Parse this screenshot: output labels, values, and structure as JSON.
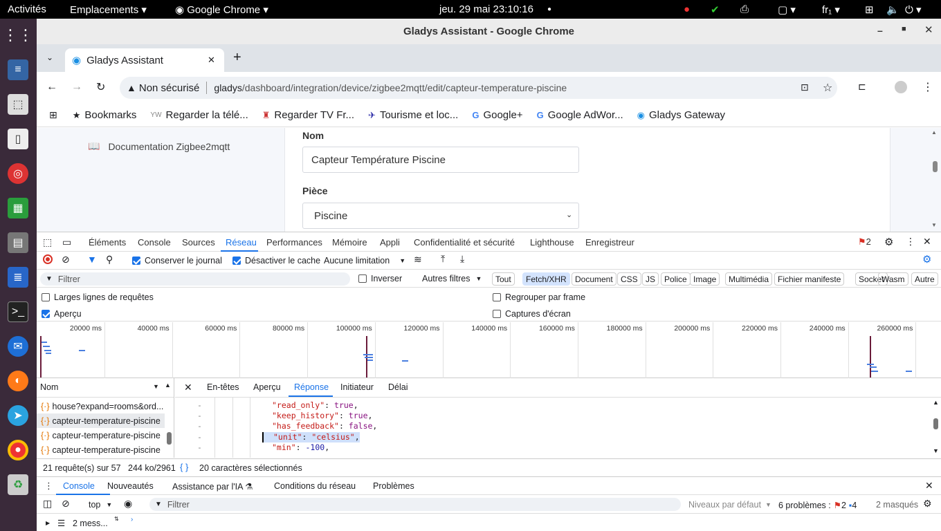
{
  "topbar": {
    "activities": "Activités",
    "places": "Emplacements",
    "app": "Google Chrome",
    "datetime": "jeu. 29 mai  23:10:16",
    "lang": "fr₁"
  },
  "window": {
    "title": "Gladys Assistant - Google Chrome"
  },
  "tab": {
    "title": "Gladys Assistant"
  },
  "omnibox": {
    "security": "Non sécurisé",
    "host": "gladys",
    "path": "/dashboard/integration/device/zigbee2mqtt/edit/capteur-temperature-piscine"
  },
  "bookmarks": [
    {
      "icon": "bookmarks-star-icon",
      "label": "Bookmarks"
    },
    {
      "icon": "yw-icon",
      "label": "Regarder la télé..."
    },
    {
      "icon": "tv-icon",
      "label": "Regarder TV Fr..."
    },
    {
      "icon": "plane-icon",
      "label": "Tourisme et loc..."
    },
    {
      "icon": "google-icon",
      "label": "Google+"
    },
    {
      "icon": "google-icon",
      "label": "Google AdWor..."
    },
    {
      "icon": "gladys-icon",
      "label": "Gladys Gateway"
    }
  ],
  "page": {
    "doc_link": "Documentation Zigbee2mqtt",
    "name_label": "Nom",
    "name_value": "Capteur Température Piscine",
    "room_label": "Pièce",
    "room_value": "Piscine"
  },
  "devtools": {
    "tabs": [
      "Éléments",
      "Console",
      "Sources",
      "Réseau",
      "Performances",
      "Mémoire",
      "Appli",
      "Confidentialité et sécurité",
      "Lighthouse",
      "Enregistreur"
    ],
    "active_tab": "Réseau",
    "issues_count": "2",
    "toolbar": {
      "preserve_log": "Conserver le journal",
      "disable_cache": "Désactiver le cache",
      "throttle": "Aucune limitation"
    },
    "filter": {
      "placeholder": "Filtrer",
      "invert": "Inverser",
      "more_filters": "Autres filtres",
      "types": [
        "Tout",
        "Fetch/XHR",
        "Document",
        "CSS",
        "JS",
        "Police",
        "Image",
        "Multimédia",
        "Fichier manifeste",
        "Socket",
        "Wasm",
        "Autre"
      ],
      "active_type": "Fetch/XHR"
    },
    "options": {
      "big_rows": "Larges lignes de requêtes",
      "overview": "Aperçu",
      "group_frame": "Regrouper par frame",
      "screenshots": "Captures d'écran"
    },
    "timeline_ticks": [
      "20000 ms",
      "40000 ms",
      "60000 ms",
      "80000 ms",
      "100000 ms",
      "120000 ms",
      "140000 ms",
      "160000 ms",
      "180000 ms",
      "200000 ms",
      "220000 ms",
      "240000 ms",
      "260000 ms"
    ],
    "list_header": "Nom",
    "requests": [
      "house?expand=rooms&ord...",
      "capteur-temperature-piscine",
      "capteur-temperature-piscine",
      "capteur-temperature-piscine"
    ],
    "detail_tabs": [
      "En-têtes",
      "Aperçu",
      "Réponse",
      "Initiateur",
      "Délai"
    ],
    "active_detail_tab": "Réponse",
    "code": [
      {
        "key": "\"read_only\"",
        "val": "true",
        "type": "k"
      },
      {
        "key": "\"keep_history\"",
        "val": "true",
        "type": "k"
      },
      {
        "key": "\"has_feedback\"",
        "val": "false",
        "type": "k"
      },
      {
        "key": "\"unit\"",
        "val": "\"celsius\"",
        "type": "s"
      },
      {
        "key": "\"min\"",
        "val": "-100",
        "type": "n"
      }
    ],
    "status": {
      "requests": "21 requête(s) sur 57",
      "size": "244 ko/2961",
      "selection": "20 caractères sélectionnés"
    }
  },
  "drawer": {
    "tabs": [
      "Console",
      "Nouveautés",
      "Assistance par l'IA",
      "Conditions du réseau",
      "Problèmes"
    ],
    "active_tab": "Console",
    "context": "top",
    "filter_placeholder": "Filtrer",
    "levels": "Niveaux par défaut",
    "issues_label": "6 problèmes :",
    "issues_errors": "2",
    "issues_info": "4",
    "hidden": "2 masqués",
    "messages": "2 mess..."
  }
}
